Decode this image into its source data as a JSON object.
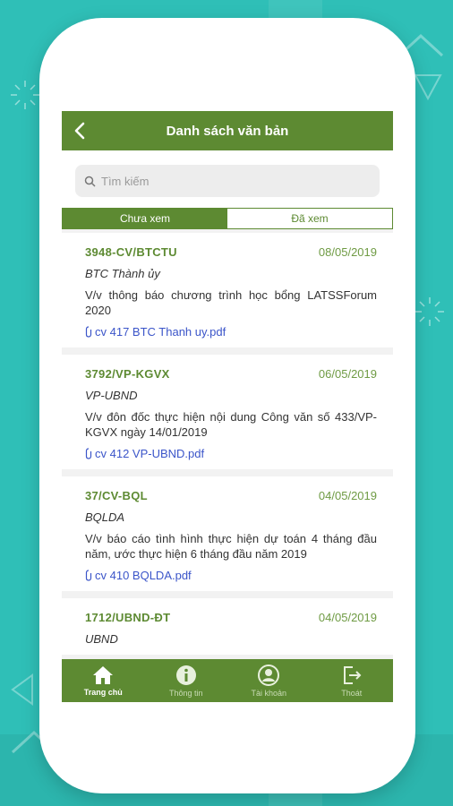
{
  "header": {
    "title": "Danh sách văn bản"
  },
  "search": {
    "placeholder": "Tìm kiếm"
  },
  "tabs": [
    {
      "label": "Chưa xem",
      "active": true
    },
    {
      "label": "Đã xem",
      "active": false
    }
  ],
  "documents": [
    {
      "code": "3948-CV/BTCTU",
      "date": "08/05/2019",
      "org": "BTC Thành ủy",
      "description": "V/v thông báo chương trình học bổng LATSSForum 2020",
      "attachment": "cv 417 BTC Thanh uy.pdf"
    },
    {
      "code": "3792/VP-KGVX",
      "date": "06/05/2019",
      "org": "VP-UBND",
      "description": "V/v đôn đốc thực hiện nội dung Công văn số 433/VP-KGVX ngày 14/01/2019",
      "attachment": "cv 412 VP-UBND.pdf"
    },
    {
      "code": "37/CV-BQL",
      "date": "04/05/2019",
      "org": "BQLDA",
      "description": "V/v báo cáo tình hình thực hiện dự toán 4 tháng đầu năm, ước thực hiện 6 tháng đầu năm 2019",
      "attachment": "cv 410 BQLDA.pdf"
    },
    {
      "code": "1712/UBND-ĐT",
      "date": "04/05/2019",
      "org": "UBND",
      "description": "",
      "attachment": ""
    }
  ],
  "tabbar": [
    {
      "label": "Trang chủ",
      "icon": "home-icon",
      "active": true
    },
    {
      "label": "Thông tin",
      "icon": "info-icon",
      "active": false
    },
    {
      "label": "Tài khoản",
      "icon": "account-icon",
      "active": false
    },
    {
      "label": "Thoát",
      "icon": "logout-icon",
      "active": false
    }
  ],
  "colors": {
    "primary": "#5d8a32",
    "background": "#2fbfb7",
    "link": "#3b55c9"
  }
}
